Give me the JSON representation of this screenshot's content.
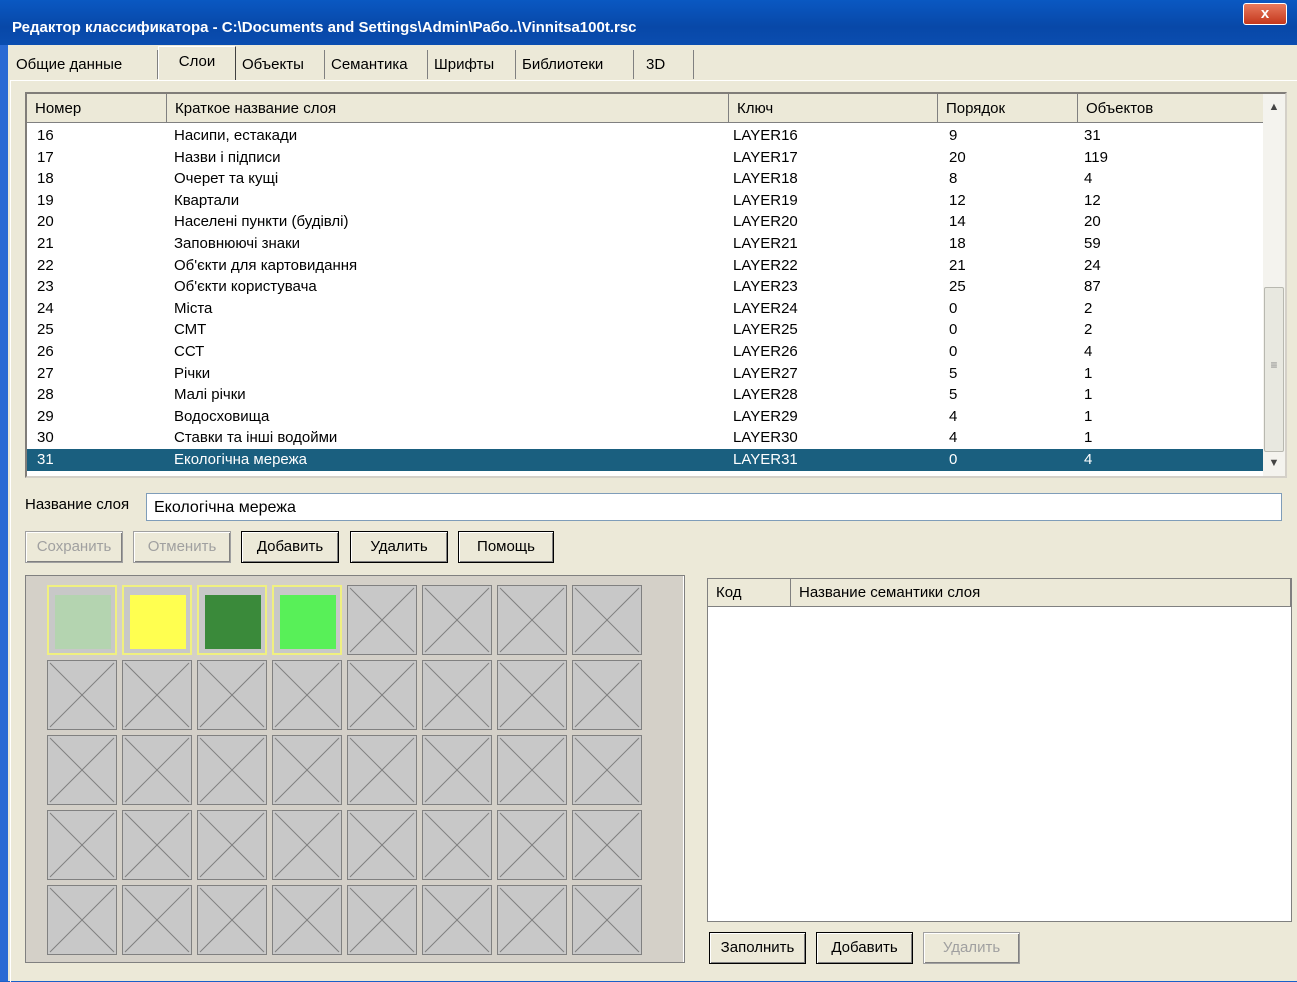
{
  "window": {
    "title": "Редактор классификатора - C:\\Documents and Settings\\Admin\\Рабо..\\Vinnitsa100t.rsc",
    "close_label": "x"
  },
  "tabs": [
    {
      "label": "Общие данные",
      "active": false
    },
    {
      "label": "Слои",
      "active": true
    },
    {
      "label": "Объекты",
      "active": false
    },
    {
      "label": "Семантика",
      "active": false
    },
    {
      "label": "Шрифты",
      "active": false
    },
    {
      "label": "Библиотеки",
      "active": false
    },
    {
      "label": "3D",
      "active": false
    }
  ],
  "layers_table": {
    "columns": [
      "Номер",
      "Краткое название слоя",
      "Ключ",
      "Порядок",
      "Объектов"
    ],
    "rows": [
      [
        "16",
        "Насипи, естакади",
        "LAYER16",
        "9",
        "31"
      ],
      [
        "17",
        "Назви і підписи",
        "LAYER17",
        "20",
        "119"
      ],
      [
        "18",
        "Очерет та кущі",
        "LAYER18",
        "8",
        "4"
      ],
      [
        "19",
        "Квартали",
        "LAYER19",
        "12",
        "12"
      ],
      [
        "20",
        "Населені пункти (будівлі)",
        "LAYER20",
        "14",
        "20"
      ],
      [
        "21",
        "Заповнюючі знаки",
        "LAYER21",
        "18",
        "59"
      ],
      [
        "22",
        "Об'єкти для картовидання",
        "LAYER22",
        "21",
        "24"
      ],
      [
        "23",
        "Об'єкти користувача",
        "LAYER23",
        "25",
        "87"
      ],
      [
        "24",
        "Міста",
        "LAYER24",
        "0",
        "2"
      ],
      [
        "25",
        "СМТ",
        "LAYER25",
        "0",
        "2"
      ],
      [
        "26",
        "ССТ",
        "LAYER26",
        "0",
        "4"
      ],
      [
        "27",
        "Річки",
        "LAYER27",
        "5",
        "1"
      ],
      [
        "28",
        "Малі річки",
        "LAYER28",
        "5",
        "1"
      ],
      [
        "29",
        "Водосховища",
        "LAYER29",
        "4",
        "1"
      ],
      [
        "30",
        "Ставки та інші водойми",
        "LAYER30",
        "4",
        "1"
      ],
      [
        "31",
        "Екологічна мережа",
        "LAYER31",
        "0",
        "4"
      ]
    ],
    "selected_row": 15
  },
  "layer_name": {
    "label": "Название слоя",
    "value": "Екологічна мережа"
  },
  "layer_buttons": {
    "save": "Сохранить",
    "cancel": "Отменить",
    "add": "Добавить",
    "delete": "Удалить",
    "help": "Помощь"
  },
  "swatches": [
    "#b4d4b0",
    "#ffff50",
    "#3a8a3a",
    "#58f058"
  ],
  "semantics_table": {
    "columns": [
      "Код",
      "Название семантики слоя"
    ]
  },
  "semantics_buttons": {
    "fill": "Заполнить",
    "add": "Добавить",
    "delete": "Удалить"
  }
}
